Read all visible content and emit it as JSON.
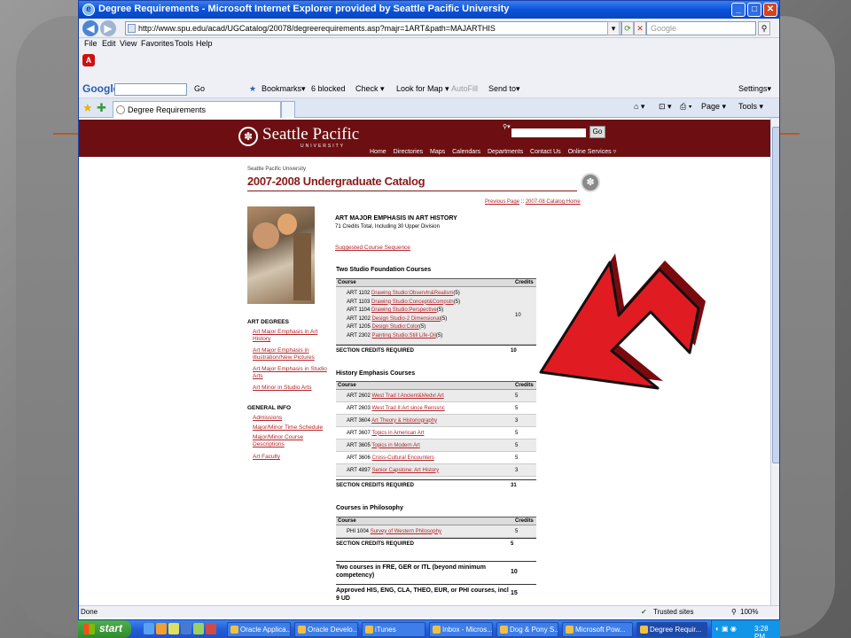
{
  "window": {
    "title": "Degree Requirements - Microsoft Internet Explorer provided by Seattle Pacific University",
    "address": "http://www.spu.edu/acad/UGCatalog/20078/degreerequirements.asp?majr=1ART&path=MAJARTHIS",
    "search_placeholder": "Google",
    "min": "_",
    "max": "□",
    "close": "✕"
  },
  "menu": [
    "File",
    "Edit",
    "View",
    "Favorites",
    "Tools",
    "Help"
  ],
  "google_toolbar": {
    "logo": "Google",
    "go": "Go",
    "bookmarks": "Bookmarks▾",
    "blocked": "6 blocked",
    "check": "Check ▾",
    "lookfor": "Look for Map ▾",
    "autofill": "AutoFill",
    "sendto": "Send to▾",
    "settings": "Settings▾"
  },
  "tab": {
    "label": "Degree Requirements",
    "page": "Page ▾",
    "tools": "Tools ▾"
  },
  "site": {
    "logo": "Seattle Pacific",
    "logo_sub": "UNIVERSITY",
    "go": "Go",
    "nav": [
      "Home",
      "Directories",
      "Maps",
      "Calendars",
      "Departments",
      "Contact Us",
      "Online Services ▿"
    ],
    "crumb": "Seattle Pacific University",
    "catalog_title": "2007-2008 Undergraduate Catalog",
    "prev_page": "Previous Page",
    "sep": " :: ",
    "catalog_home": "2007-08 Catalog Home"
  },
  "sidebar": {
    "art_degrees_heading": "ART DEGREES",
    "art_degrees": [
      "Art Major Emphasis in Art History",
      "Art Major Emphasis in Illustration/New Pictures",
      "Art Major Emphasis in Studio Arts",
      "Art Minor in Studio Arts"
    ],
    "general_heading": "GENERAL INFO",
    "general": [
      "Admissions",
      "Major/Minor Time Schedule",
      "Major/Minor Course Descriptions",
      "Art Faculty"
    ]
  },
  "program": {
    "title": "ART MAJOR EMPHASIS IN ART HISTORY",
    "subtitle": "71 Credits Total, Including 30 Upper Division",
    "sequence_link": "Suggested Course Sequence"
  },
  "sections": {
    "studio": {
      "title": "Two Studio Foundation Courses",
      "col_course": "Course",
      "col_credits": "Credits",
      "rows": [
        {
          "num": "ART 1102",
          "name": "Drawing Studio:Observtn&Realism",
          "cr": "(5)"
        },
        {
          "num": "ART 1103",
          "name": "Drawing Studio:Concept&Compstn",
          "cr": "(5)"
        },
        {
          "num": "ART 1104",
          "name": "Drawing Studio:Perspective",
          "cr": "(5)"
        },
        {
          "num": "ART 1202",
          "name": "Design Studio-2 Dimensional",
          "cr": "(5)"
        },
        {
          "num": "ART 1205",
          "name": "Design Studio:Color",
          "cr": "(5)"
        },
        {
          "num": "ART 2302",
          "name": "Painting Studio:Still Life-Oil",
          "cr": "(5)"
        }
      ],
      "credits": "10",
      "total_label": "SECTION CREDITS REQUIRED",
      "total": "10"
    },
    "history": {
      "title": "History Emphasis Courses",
      "col_course": "Course",
      "col_credits": "Credits",
      "rows": [
        {
          "num": "ART 2602",
          "name": "West Trad I:Ancient&Medvl Art",
          "cr": "5"
        },
        {
          "num": "ART 2603",
          "name": "West Trad II:Art since Renssnc",
          "cr": "5"
        },
        {
          "num": "ART 3604",
          "name": "Art Theory & Historiography",
          "cr": "3"
        },
        {
          "num": "ART 3607",
          "name": "Topics in American Art",
          "cr": "5"
        },
        {
          "num": "ART 3605",
          "name": "Topics in Modern Art",
          "cr": "5"
        },
        {
          "num": "ART 3606",
          "name": "Cross-Cultural Encounters",
          "cr": "5"
        },
        {
          "num": "ART 4897",
          "name": "Senior Capstone: Art History",
          "cr": "3"
        }
      ],
      "total_label": "SECTION CREDITS REQUIRED",
      "total": "31"
    },
    "philosophy": {
      "title": "Courses in Philosophy",
      "col_course": "Course",
      "col_credits": "Credits",
      "rows": [
        {
          "num": "PHI 1004",
          "name": "Survey of Western Philosophy",
          "cr": "5"
        }
      ],
      "total_label": "SECTION CREDITS REQUIRED",
      "total": "5"
    },
    "languages": {
      "label": "Two courses in FRE, GER or ITL (beyond minimum competency)",
      "credits": "10"
    },
    "approved": {
      "label": "Approved HIS, ENG, CLA, THEO, EUR, or PHI courses, incl 9 UD",
      "credits": "15"
    }
  },
  "status": {
    "left": "Done",
    "zone": "Trusted sites",
    "zoom": "100%"
  },
  "taskbar": {
    "start": "start",
    "items": [
      "Oracle Applica...",
      "Oracle Develo...",
      "iTunes",
      "Inbox - Micros...",
      "Dog & Pony S...",
      "Microsoft Pow...",
      "Degree Requir..."
    ],
    "clock": "3:28 PM"
  },
  "colors": {
    "maroon": "#6d0f12",
    "link": "#b3252b",
    "arrow": "#d6181f"
  }
}
